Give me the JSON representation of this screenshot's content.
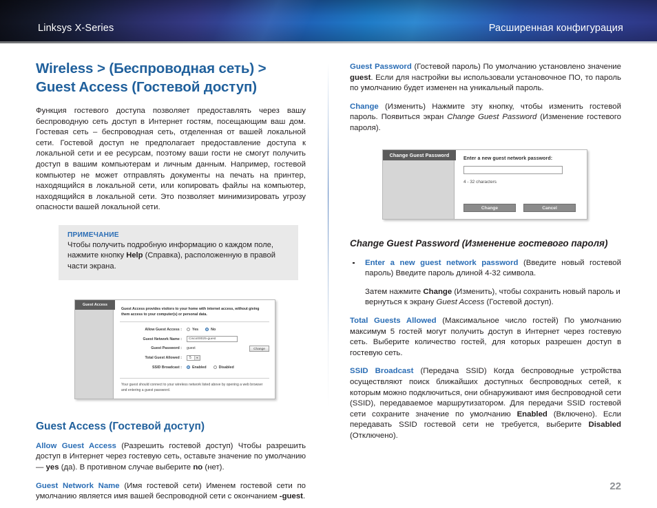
{
  "header": {
    "left_title": "Linksys X-Series",
    "right_title": "Расширенная конфигурация"
  },
  "left_column": {
    "section_title": "Wireless > (Беспроводная сеть) > Guest Access (Гостевой доступ)",
    "intro_paragraph": "Функция гостевого доступа позволяет предоставлять через вашу беспроводную сеть доступ в Интернет гостям, посещающим ваш дом. Гостевая сеть – беспроводная сеть, отделенная от вашей локальной сети. Гостевой доступ не предполагает предоставление доступа к локальной сети и ее ресурсам, поэтому ваши гости не смогут получить доступ в вашим компьютерам и личным данным. Например, гостевой компьютер не может отправлять документы на печать на принтер, находящийся в локальной сети, или копировать файлы на компьютер, находящийся в локальной сети. Это позволяет минимизировать угрозу опасности вашей локальной сети.",
    "note": {
      "label": "ПРИМЕЧАНИЕ",
      "text_before": "Чтобы получить подробную информацию о каждом поле, нажмите кнопку ",
      "bold_term": "Help",
      "text_after": " (Справка), расположенную в правой части экрана."
    },
    "sub_title": "Guest Access (Гостевой доступ)",
    "allow_guest_access": {
      "term": "Allow Guest Access",
      "text_1": " (Разрешить гостевой доступ)  Чтобы разрешить доступ в Интернет через гостевую сеть, оставьте значение по умолчанию — ",
      "bold_1": "yes",
      "text_2": " (да). В противном случае выберите ",
      "bold_2": "no",
      "text_3": " (нет)."
    },
    "guest_network_name": {
      "term": "Guest Network Name",
      "text_1": " (Имя гостевой сети) Именем гостевой сети по умолчанию является имя вашей беспроводной сети с окончанием ",
      "bold_1": "-guest",
      "text_2": "."
    }
  },
  "guest_access_screenshot": {
    "tab_label": "Guest Access",
    "intro": "Guest Access provides visitors to your home with internet access, without giving them access to your computer(s) or personal data.",
    "rows": [
      {
        "label": "Allow Guest Access :",
        "type": "radio",
        "option_1": "Yes",
        "option_2": "No",
        "selected": "No"
      },
      {
        "label": "Guest Network Name :",
        "type": "text",
        "value": "Cisco00025-guest"
      },
      {
        "label": "Guest Password :",
        "type": "plain",
        "value": "guest",
        "button": "Change"
      },
      {
        "label": "Total Guest Allowed :",
        "type": "select",
        "value": "5"
      },
      {
        "label": "SSID Broadcast :",
        "type": "radio",
        "option_1": "Enabled",
        "option_2": "Disabled",
        "selected": "Enabled"
      }
    ],
    "footer": "Your guest should connect to your wireless network listed above by opening a web browser and entering a guest password."
  },
  "right_column": {
    "guest_password": {
      "term": "Guest Password",
      "text_1": " (Гостевой пароль)  По умолчанию установлено значение ",
      "bold_1": "guest",
      "text_2": ". Если для настройки вы использовали установочное ПО, то пароль по умолчанию будет изменен на уникальный пароль."
    },
    "change": {
      "term": "Change",
      "text_1": " (Изменить)  Нажмите эту кнопку, чтобы изменить гостевой пароль. Появиться экран ",
      "italic_1": "Change Guest Password",
      "text_2": " (Изменение гостевого пароля)."
    },
    "change_password_title": "Change Guest Password (Изменение гостевого пароля)",
    "bullet_enter_password": {
      "term": "Enter a new guest network password",
      "text_1": " (Введите новый гостевой пароль)  Введите пароль длиной 4-32 символа."
    },
    "then_press": {
      "text_1": "Затем нажмите ",
      "bold_1": "Change",
      "text_2": " (Изменить), чтобы сохранить новый пароль и вернуться к экрану ",
      "italic_1": "Guest Access",
      "text_3": " (Гостевой доступ)."
    },
    "total_guests_allowed": {
      "term": "Total Guests Allowed",
      "text_1": " (Максимальное число гостей) По умолчанию максимум 5 гостей могут получить доступ в Интернет через гостевую сеть. Выберите количество гостей, для которых разрешен доступ в гостевую сеть."
    },
    "ssid_broadcast": {
      "term": "SSID Broadcast",
      "text_1": " (Передача SSID) Когда беспроводные устройства осуществляют поиск ближайших доступных беспроводных сетей, к которым можно подключиться, они обнаруживают имя беспроводной сети (SSID), передаваемое маршрутизатором. Для передачи SSID гостевой сети сохраните значение по умолчанию ",
      "bold_1": "Enabled",
      "text_2": " (Включено). Если передавать SSID гостевой сети не требуется, выберите ",
      "bold_2": "Disabled",
      "text_3": " (Отключено)."
    }
  },
  "change_password_dialog": {
    "tab_label": "Change Guest Password",
    "prompt": "Enter a new guest network password:",
    "input_value": "",
    "hint": "4 - 32 characters",
    "button_change": "Change",
    "button_cancel": "Cancel"
  },
  "footer": {
    "page_number": "22"
  },
  "colors": {
    "accent_blue": "#2a6db5",
    "heading_blue": "#20609c",
    "note_bg": "#e9e9e9",
    "page_number_gray": "#8f9296"
  }
}
